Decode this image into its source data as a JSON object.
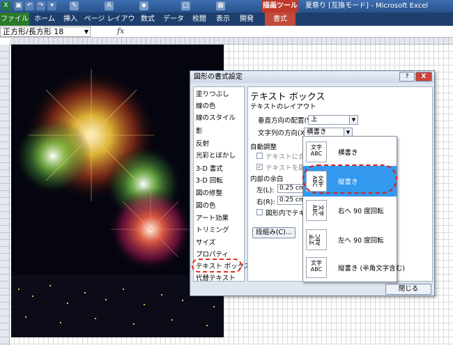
{
  "titlebar": {
    "tool_tab": "描画ツール",
    "window_title": "夏祭り [互換モード] - Microsoft Excel"
  },
  "ribbon": {
    "tabs": [
      {
        "label": "ファイル"
      },
      {
        "label": "ホーム"
      },
      {
        "label": "挿入"
      },
      {
        "label": "ページ レイアウト"
      },
      {
        "label": "数式"
      },
      {
        "label": "データ"
      },
      {
        "label": "校閲"
      },
      {
        "label": "表示"
      },
      {
        "label": "開発"
      },
      {
        "label": "書式"
      }
    ]
  },
  "formula_bar": {
    "name_box": "正方形/長方形 18",
    "fx": "fx"
  },
  "dialog": {
    "title": "図形の書式設定",
    "help": "?",
    "close": "X",
    "sidebar": [
      "塗りつぶし",
      "線の色",
      "線のスタイル",
      "影",
      "反射",
      "光彩とぼかし",
      "3-D 書式",
      "3-D 回転",
      "図の修整",
      "図の色",
      "アート効果",
      "トリミング",
      "サイズ",
      "プロパティ",
      "テキスト ボックス",
      "代替テキスト"
    ],
    "panel": {
      "title": "テキスト ボックス",
      "layout_section": "テキストのレイアウト",
      "vertical_align_label": "垂直方向の配置(V):",
      "vertical_align_value": "上",
      "text_direction_label": "文字列の方向(X):",
      "text_direction_value": "横書き",
      "autofit_section": "自動調整",
      "autofit_resize": "テキストに合わせ",
      "autofit_wrap": "テキストを図形か",
      "margin_section": "内部の余白",
      "left_label": "左(L):",
      "left_value": "0.25 cm",
      "right_label": "右(R):",
      "right_value": "0.25 cm",
      "wrap_in_shape": "図形内でテキスト",
      "columns_button": "段組み(C)..."
    },
    "close_button": "閉じる"
  },
  "dropdown": {
    "options": [
      {
        "label": "横書き",
        "icon": "文字\nABC"
      },
      {
        "label": "縦書き",
        "icon": "文字\nABC"
      },
      {
        "label": "右へ 90 度回転",
        "icon": "文字\nABC"
      },
      {
        "label": "左へ 90 度回転",
        "icon": "文字\nABC"
      },
      {
        "label": "縦書き (半角文字含む)",
        "icon": "文字\nABC"
      }
    ],
    "selected_index": 1
  }
}
